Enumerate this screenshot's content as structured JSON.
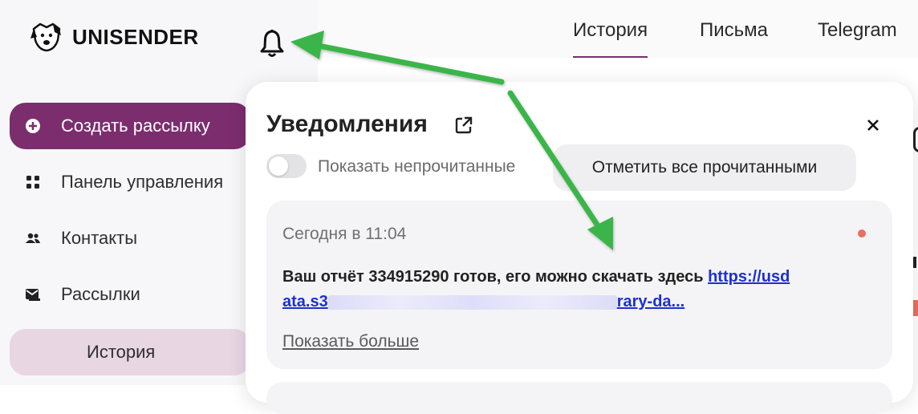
{
  "brand": {
    "name": "UNISENDER"
  },
  "sidebar": {
    "items": [
      {
        "label": "Создать рассылку",
        "icon": "plus-circle-icon"
      },
      {
        "label": "Панель управления",
        "icon": "grid-icon"
      },
      {
        "label": "Контакты",
        "icon": "users-icon"
      },
      {
        "label": "Рассылки",
        "icon": "mail-icon"
      },
      {
        "label": "История",
        "icon": ""
      }
    ]
  },
  "tabs": [
    {
      "label": "История",
      "active": true
    },
    {
      "label": "Письма",
      "active": false
    },
    {
      "label": "Telegram",
      "active": false
    }
  ],
  "notifications": {
    "title": "Уведомления",
    "toggle_label": "Показать непрочитанные",
    "mark_all_label": "Отметить все прочитанными",
    "items": [
      {
        "time": "Сегодня в 11:04",
        "text": "Ваш отчёт 334915290 готов, его можно скачать здесь",
        "link_start": "https://usd",
        "link_line2_prefix": "ata.s3",
        "link_line2_suffix": "rary-da...",
        "show_more": "Показать больше",
        "unread": true
      }
    ]
  },
  "colors": {
    "accent": "#7b2d6e",
    "accent_light": "#e8d6e3",
    "link": "#1c2fd6",
    "unread_dot": "#e8705f",
    "arrow": "#3bb54a"
  }
}
